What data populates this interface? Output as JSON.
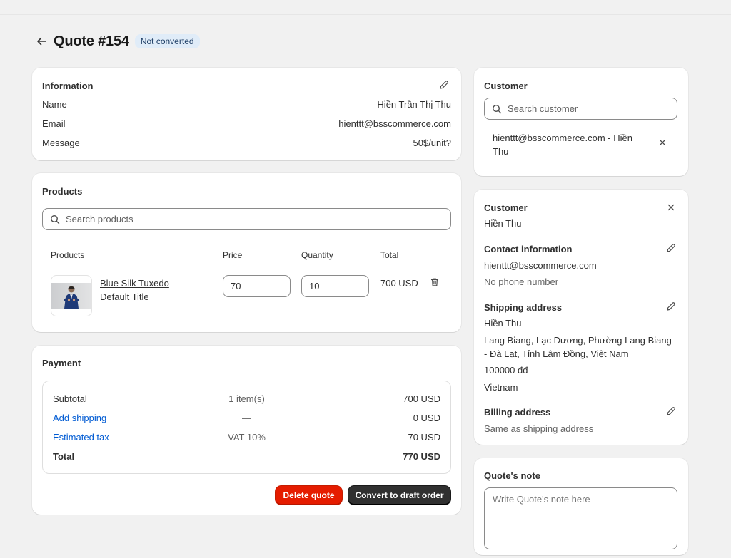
{
  "header": {
    "title": "Quote #154",
    "status": "Not converted"
  },
  "information": {
    "title": "Information",
    "rows": [
      {
        "label": "Name",
        "value": "Hiền Trần Thị Thu"
      },
      {
        "label": "Email",
        "value": "hienttt@bsscommerce.com"
      },
      {
        "label": "Message",
        "value": "50$/unit?"
      }
    ]
  },
  "products": {
    "title": "Products",
    "search_placeholder": "Search products",
    "columns": [
      "Products",
      "Price",
      "Quantity",
      "Total"
    ],
    "items": [
      {
        "name": "Blue Silk Tuxedo",
        "variant": "Default Title",
        "price": "70",
        "quantity": "10",
        "total": "700 USD"
      }
    ]
  },
  "payment": {
    "title": "Payment",
    "rows": [
      {
        "label": "Subtotal",
        "middle": "1 item(s)",
        "value": "700 USD"
      },
      {
        "label": "Add shipping",
        "middle": "—",
        "value": "0 USD"
      },
      {
        "label": "Estimated tax",
        "middle": "VAT 10%",
        "value": "70 USD"
      },
      {
        "label": "Total",
        "middle": "",
        "value": "770 USD"
      }
    ],
    "delete_label": "Delete quote",
    "convert_label": "Convert to draft order"
  },
  "customer_search": {
    "title": "Customer",
    "search_placeholder": "Search customer",
    "selected_line1": "hienttt@bsscommerce.com - Hiền",
    "selected_line2": "Thu"
  },
  "customer_detail": {
    "title": "Customer",
    "name": "Hiền Thu",
    "contact_title": "Contact information",
    "email": "hienttt@bsscommerce.com",
    "phone": "No phone number",
    "shipping_title": "Shipping address",
    "shipping_name": "Hiền Thu",
    "shipping_line1": "Lang Biang, Lạc Dương, Phường Lang Biang",
    "shipping_line2": "- Đà Lạt, Tỉnh Lâm Đồng, Việt Nam",
    "shipping_zip": "100000 đđ",
    "shipping_country": "Vietnam",
    "billing_title": "Billing address",
    "billing_value": "Same as shipping address"
  },
  "quote_note": {
    "title": "Quote's note",
    "placeholder": "Write Quote's note here"
  },
  "colors": {
    "accent_link": "#005bd3",
    "danger": "#e51c00",
    "dark_button": "#303030",
    "badge_bg": "#e0ecf8"
  },
  "icons": [
    "back-arrow-icon",
    "pencil-icon",
    "search-icon",
    "close-icon",
    "trash-icon"
  ]
}
